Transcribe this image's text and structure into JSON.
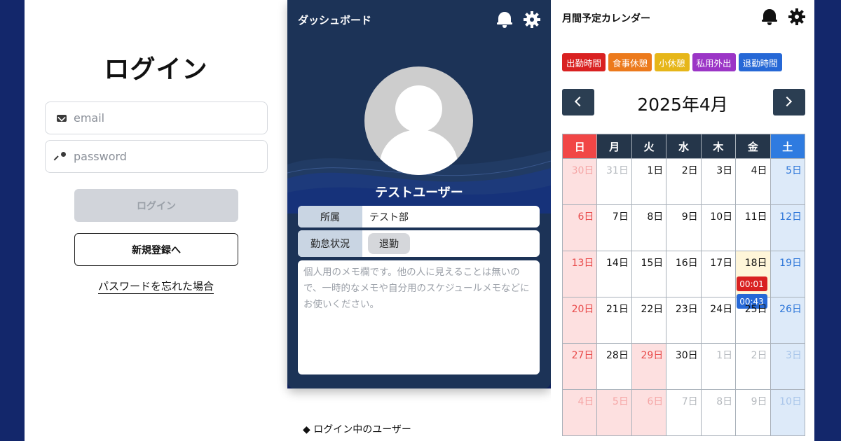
{
  "login": {
    "title": "ログイン",
    "email_placeholder": "email",
    "password_placeholder": "password",
    "login_button": "ログイン",
    "register_button": "新規登録へ",
    "forgot_link": "パスワードを忘れた場合"
  },
  "dashboard": {
    "title": "ダッシュボード",
    "username": "テストユーザー",
    "dept_label": "所属",
    "dept_value": "テスト部",
    "status_label": "勤怠状況",
    "status_value": "退勤",
    "memo_placeholder": "個人用のメモ欄です。他の人に見えることは無いので、一時的なメモや自分用のスケジュールメモなどにお使いください。",
    "online_users": "◆ ログイン中のユーザー"
  },
  "calendar": {
    "title": "月間予定カレンダー",
    "month": "2025年4月",
    "legend": [
      {
        "label": "出勤時間",
        "color": "#d92121"
      },
      {
        "label": "食事休憩",
        "color": "#ec7a1c"
      },
      {
        "label": "小休憩",
        "color": "#e6b619"
      },
      {
        "label": "私用外出",
        "color": "#9b35c6"
      },
      {
        "label": "退勤時間",
        "color": "#2668d6"
      }
    ],
    "weekdays": [
      "日",
      "月",
      "火",
      "水",
      "木",
      "金",
      "土"
    ],
    "weeks": [
      [
        {
          "d": "30日",
          "o": true
        },
        {
          "d": "31日",
          "o": true
        },
        {
          "d": "1日"
        },
        {
          "d": "2日"
        },
        {
          "d": "3日"
        },
        {
          "d": "4日"
        },
        {
          "d": "5日"
        }
      ],
      [
        {
          "d": "6日"
        },
        {
          "d": "7日"
        },
        {
          "d": "8日"
        },
        {
          "d": "9日"
        },
        {
          "d": "10日"
        },
        {
          "d": "11日"
        },
        {
          "d": "12日"
        }
      ],
      [
        {
          "d": "13日"
        },
        {
          "d": "14日"
        },
        {
          "d": "15日"
        },
        {
          "d": "16日"
        },
        {
          "d": "17日"
        },
        {
          "d": "18日",
          "today": true,
          "records": [
            {
              "time": "00:01",
              "color": "#d92121"
            },
            {
              "time": "00:43",
              "color": "#2668d6"
            }
          ]
        },
        {
          "d": "19日"
        }
      ],
      [
        {
          "d": "20日"
        },
        {
          "d": "21日"
        },
        {
          "d": "22日"
        },
        {
          "d": "23日"
        },
        {
          "d": "24日"
        },
        {
          "d": "25日"
        },
        {
          "d": "26日"
        }
      ],
      [
        {
          "d": "27日"
        },
        {
          "d": "28日"
        },
        {
          "d": "29日",
          "holiday": true
        },
        {
          "d": "30日"
        },
        {
          "d": "1日",
          "o": true
        },
        {
          "d": "2日",
          "o": true
        },
        {
          "d": "3日",
          "o": true
        }
      ],
      [
        {
          "d": "4日",
          "o": true
        },
        {
          "d": "5日",
          "o": true,
          "holiday": true
        },
        {
          "d": "6日",
          "o": true,
          "holiday": true
        },
        {
          "d": "7日",
          "o": true
        },
        {
          "d": "8日",
          "o": true
        },
        {
          "d": "9日",
          "o": true
        },
        {
          "d": "10日",
          "o": true
        }
      ]
    ]
  },
  "icons": {
    "notifications": "bell-icon",
    "settings": "gear-icon",
    "email": "mail-icon",
    "password": "key-icon",
    "prev_month": "chevron-left-icon",
    "next_month": "chevron-right-icon"
  }
}
